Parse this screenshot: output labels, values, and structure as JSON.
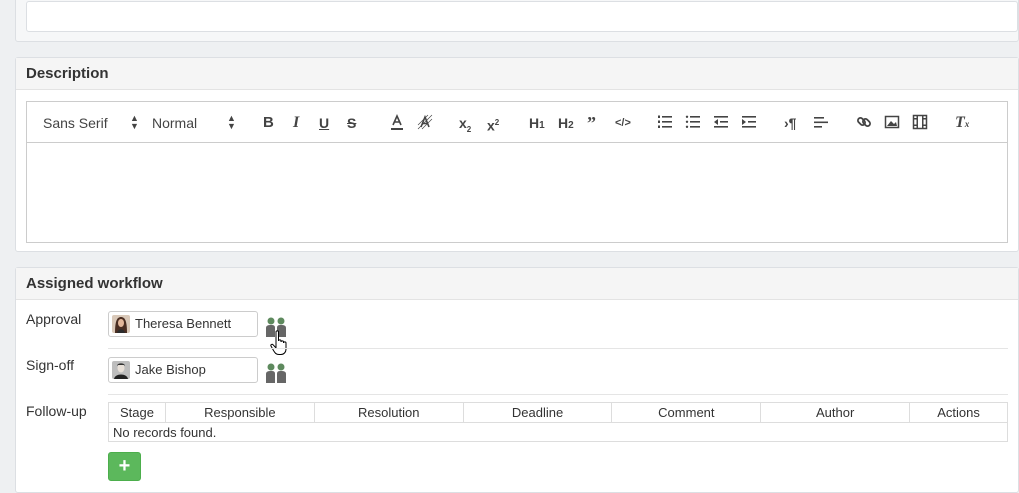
{
  "description": {
    "title": "Description",
    "toolbar": {
      "font_family": "Sans Serif",
      "font_size": "Normal",
      "buttons": [
        "bold",
        "italic",
        "underline",
        "strike",
        "color",
        "background",
        "subscript",
        "superscript",
        "header-1",
        "header-2",
        "blockquote",
        "code-block",
        "ordered-list",
        "bullet-list",
        "outdent",
        "indent",
        "direction",
        "align",
        "link",
        "image",
        "video",
        "clean"
      ]
    },
    "content": ""
  },
  "workflow": {
    "title": "Assigned workflow",
    "approval": {
      "label": "Approval",
      "user": "Theresa Bennett"
    },
    "signoff": {
      "label": "Sign-off",
      "user": "Jake Bishop"
    },
    "followup": {
      "label": "Follow-up",
      "columns": [
        "Stage",
        "Responsible",
        "Resolution",
        "Deadline",
        "Comment",
        "Author",
        "Actions"
      ],
      "empty_text": "No records found.",
      "add_label": "+"
    },
    "colors": {
      "accent_green": "#5cb85c",
      "users_icon": "#5e8a5e"
    }
  }
}
